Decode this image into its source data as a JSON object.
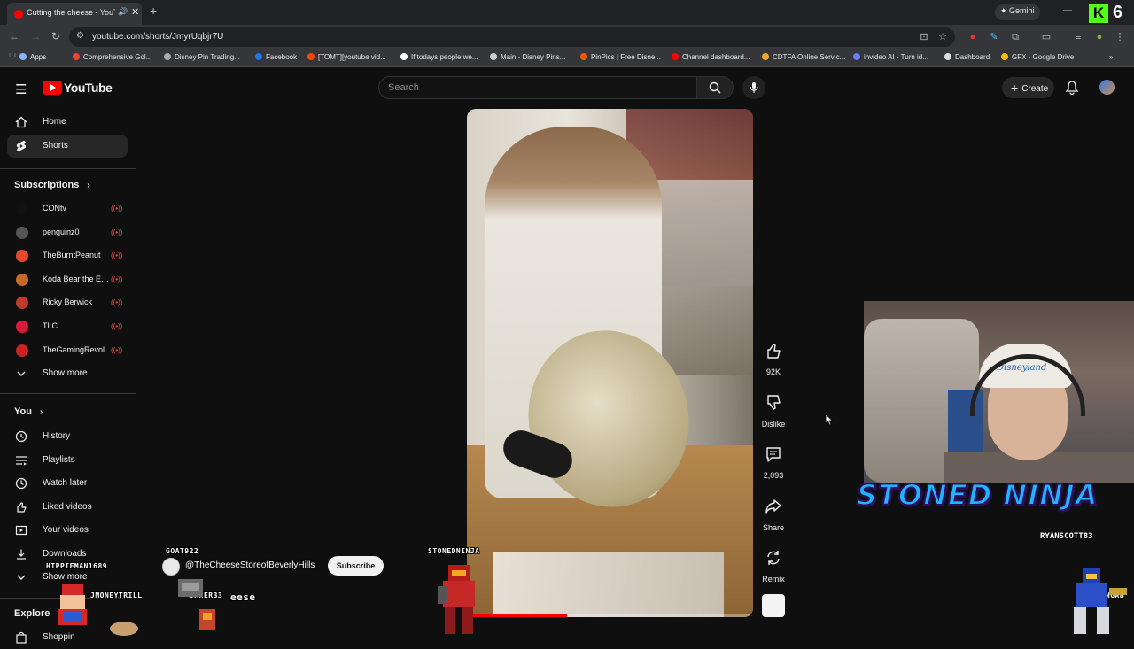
{
  "browser": {
    "tab_title": "Cutting the cheese - YouTube",
    "url": "youtube.com/shorts/JmyrUqbjr7U",
    "gemini_label": "Gemini",
    "kick_letter": "K",
    "kick_count": "6",
    "bookmarks": [
      {
        "label": "Apps",
        "color": "#8ab4f8"
      },
      {
        "label": "Comprehensive Gol...",
        "color": "#ea4335"
      },
      {
        "label": "Disney Pin Trading...",
        "color": "#aaaaaa"
      },
      {
        "label": "Facebook",
        "color": "#1877f2"
      },
      {
        "label": "[TOMT][youtube vid...",
        "color": "#ff4500"
      },
      {
        "label": "If todays people we...",
        "color": "#ffffff"
      },
      {
        "label": "Main - Disney Pins...",
        "color": "#cccccc"
      },
      {
        "label": "PinPics | Free Disne...",
        "color": "#ff5500"
      },
      {
        "label": "Channel dashboard...",
        "color": "#ff0000"
      },
      {
        "label": "CDTFA Online Servic...",
        "color": "#f4a62a"
      },
      {
        "label": "invideo AI - Turn id...",
        "color": "#6b7cff"
      },
      {
        "label": "Dashboard",
        "color": "#dddddd"
      },
      {
        "label": "GFX - Google Drive",
        "color": "#fbbc04"
      }
    ]
  },
  "header": {
    "logo_text": "YouTube",
    "search_placeholder": "Search",
    "create_label": "Create"
  },
  "sidebar": {
    "primary": [
      {
        "label": "Home",
        "icon": "home-icon"
      },
      {
        "label": "Shorts",
        "icon": "shorts-icon"
      }
    ],
    "subscriptions_title": "Subscriptions",
    "subscriptions": [
      {
        "label": "CONtv",
        "color": "#111111"
      },
      {
        "label": "penguinz0",
        "color": "#555555"
      },
      {
        "label": "TheBurntPeanut",
        "color": "#e24a2a"
      },
      {
        "label": "Koda Bear the Ex...",
        "color": "#c56a2a"
      },
      {
        "label": "Ricky Berwick",
        "color": "#c0392b"
      },
      {
        "label": "TLC",
        "color": "#d81b3a"
      },
      {
        "label": "TheGamingRevol...",
        "color": "#cc2222"
      }
    ],
    "show_more": "Show more",
    "you_title": "You",
    "you_items": [
      {
        "label": "History",
        "icon": "history-icon"
      },
      {
        "label": "Playlists",
        "icon": "playlists-icon"
      },
      {
        "label": "Watch later",
        "icon": "watch-later-icon"
      },
      {
        "label": "Liked videos",
        "icon": "liked-icon"
      },
      {
        "label": "Your videos",
        "icon": "your-videos-icon"
      },
      {
        "label": "Downloads",
        "icon": "download-icon"
      }
    ],
    "show_more_2": "Show more",
    "explore_title": "Explore",
    "shopping_partial": "Shoppin"
  },
  "short": {
    "likes": "92K",
    "dislike_label": "Dislike",
    "comments": "2,093",
    "share_label": "Share",
    "remix_label": "Remix",
    "channel_handle": "@TheCheeseStoreofBeverlyHills",
    "subscribe_label": "Subscribe",
    "progress_fraction": 0.35
  },
  "overlay": {
    "chat_names": [
      "GOAT922",
      "HIPPIEMAN1689",
      "JMONEYTRILL",
      "JAHER33",
      "eese",
      "STONEDNINJA",
      "SLANGINGAB"
    ],
    "streamer_name": "STONED NINJA",
    "streamer_handle": "RYANSCOTT83",
    "cap_text": "Disneyland"
  }
}
